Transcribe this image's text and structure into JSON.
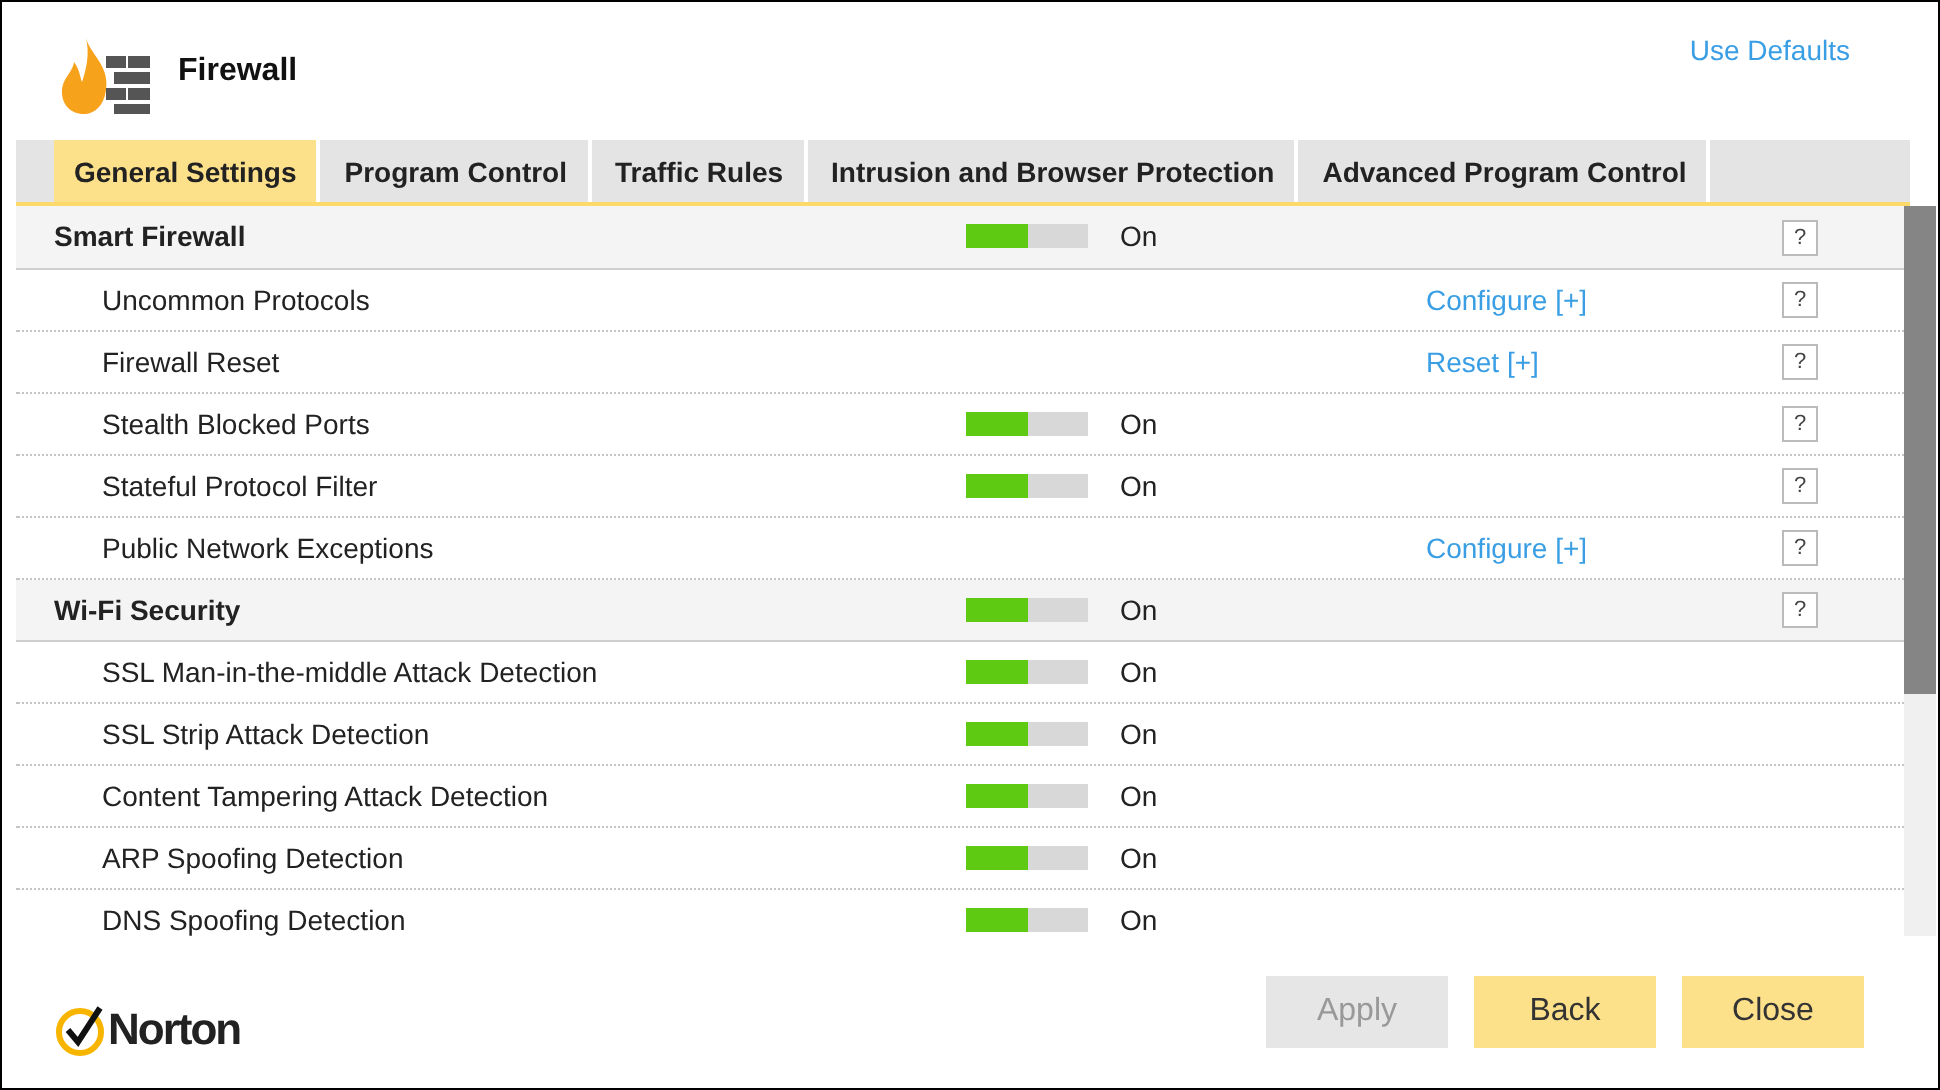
{
  "window": {
    "title": "Firewall"
  },
  "header_link": "Use Defaults",
  "tabs": [
    {
      "label": "General Settings",
      "selected": true
    },
    {
      "label": "Program Control",
      "selected": false
    },
    {
      "label": "Traffic Rules",
      "selected": false
    },
    {
      "label": "Intrusion and Browser Protection",
      "selected": false
    },
    {
      "label": "Advanced Program Control",
      "selected": false
    }
  ],
  "rows": [
    {
      "kind": "section",
      "label": "Smart Firewall",
      "toggle": {
        "on": true,
        "status": "On"
      },
      "help": "?"
    },
    {
      "kind": "item",
      "label": "Uncommon Protocols",
      "link": "Configure [+]",
      "help": "?"
    },
    {
      "kind": "item",
      "label": "Firewall Reset",
      "link": "Reset [+]",
      "help": "?"
    },
    {
      "kind": "item",
      "label": "Stealth Blocked Ports",
      "toggle": {
        "on": true,
        "status": "On"
      },
      "help": "?"
    },
    {
      "kind": "item",
      "label": "Stateful Protocol Filter",
      "toggle": {
        "on": true,
        "status": "On"
      },
      "help": "?"
    },
    {
      "kind": "item",
      "label": "Public Network Exceptions",
      "link": "Configure [+]",
      "help": "?"
    },
    {
      "kind": "section",
      "label": "Wi-Fi Security",
      "toggle": {
        "on": true,
        "status": "On"
      },
      "help": "?"
    },
    {
      "kind": "item",
      "label": "SSL Man-in-the-middle Attack Detection",
      "toggle": {
        "on": true,
        "status": "On"
      }
    },
    {
      "kind": "item",
      "label": "SSL Strip Attack Detection",
      "toggle": {
        "on": true,
        "status": "On"
      }
    },
    {
      "kind": "item",
      "label": "Content Tampering Attack Detection",
      "toggle": {
        "on": true,
        "status": "On"
      }
    },
    {
      "kind": "item",
      "label": "ARP Spoofing Detection",
      "toggle": {
        "on": true,
        "status": "On"
      }
    },
    {
      "kind": "item",
      "label": "DNS Spoofing Detection",
      "toggle": {
        "on": true,
        "status": "On"
      }
    }
  ],
  "brand": "Norton",
  "buttons": [
    {
      "label": "Apply",
      "disabled": true
    },
    {
      "label": "Back",
      "disabled": false
    },
    {
      "label": "Close",
      "disabled": false
    }
  ]
}
